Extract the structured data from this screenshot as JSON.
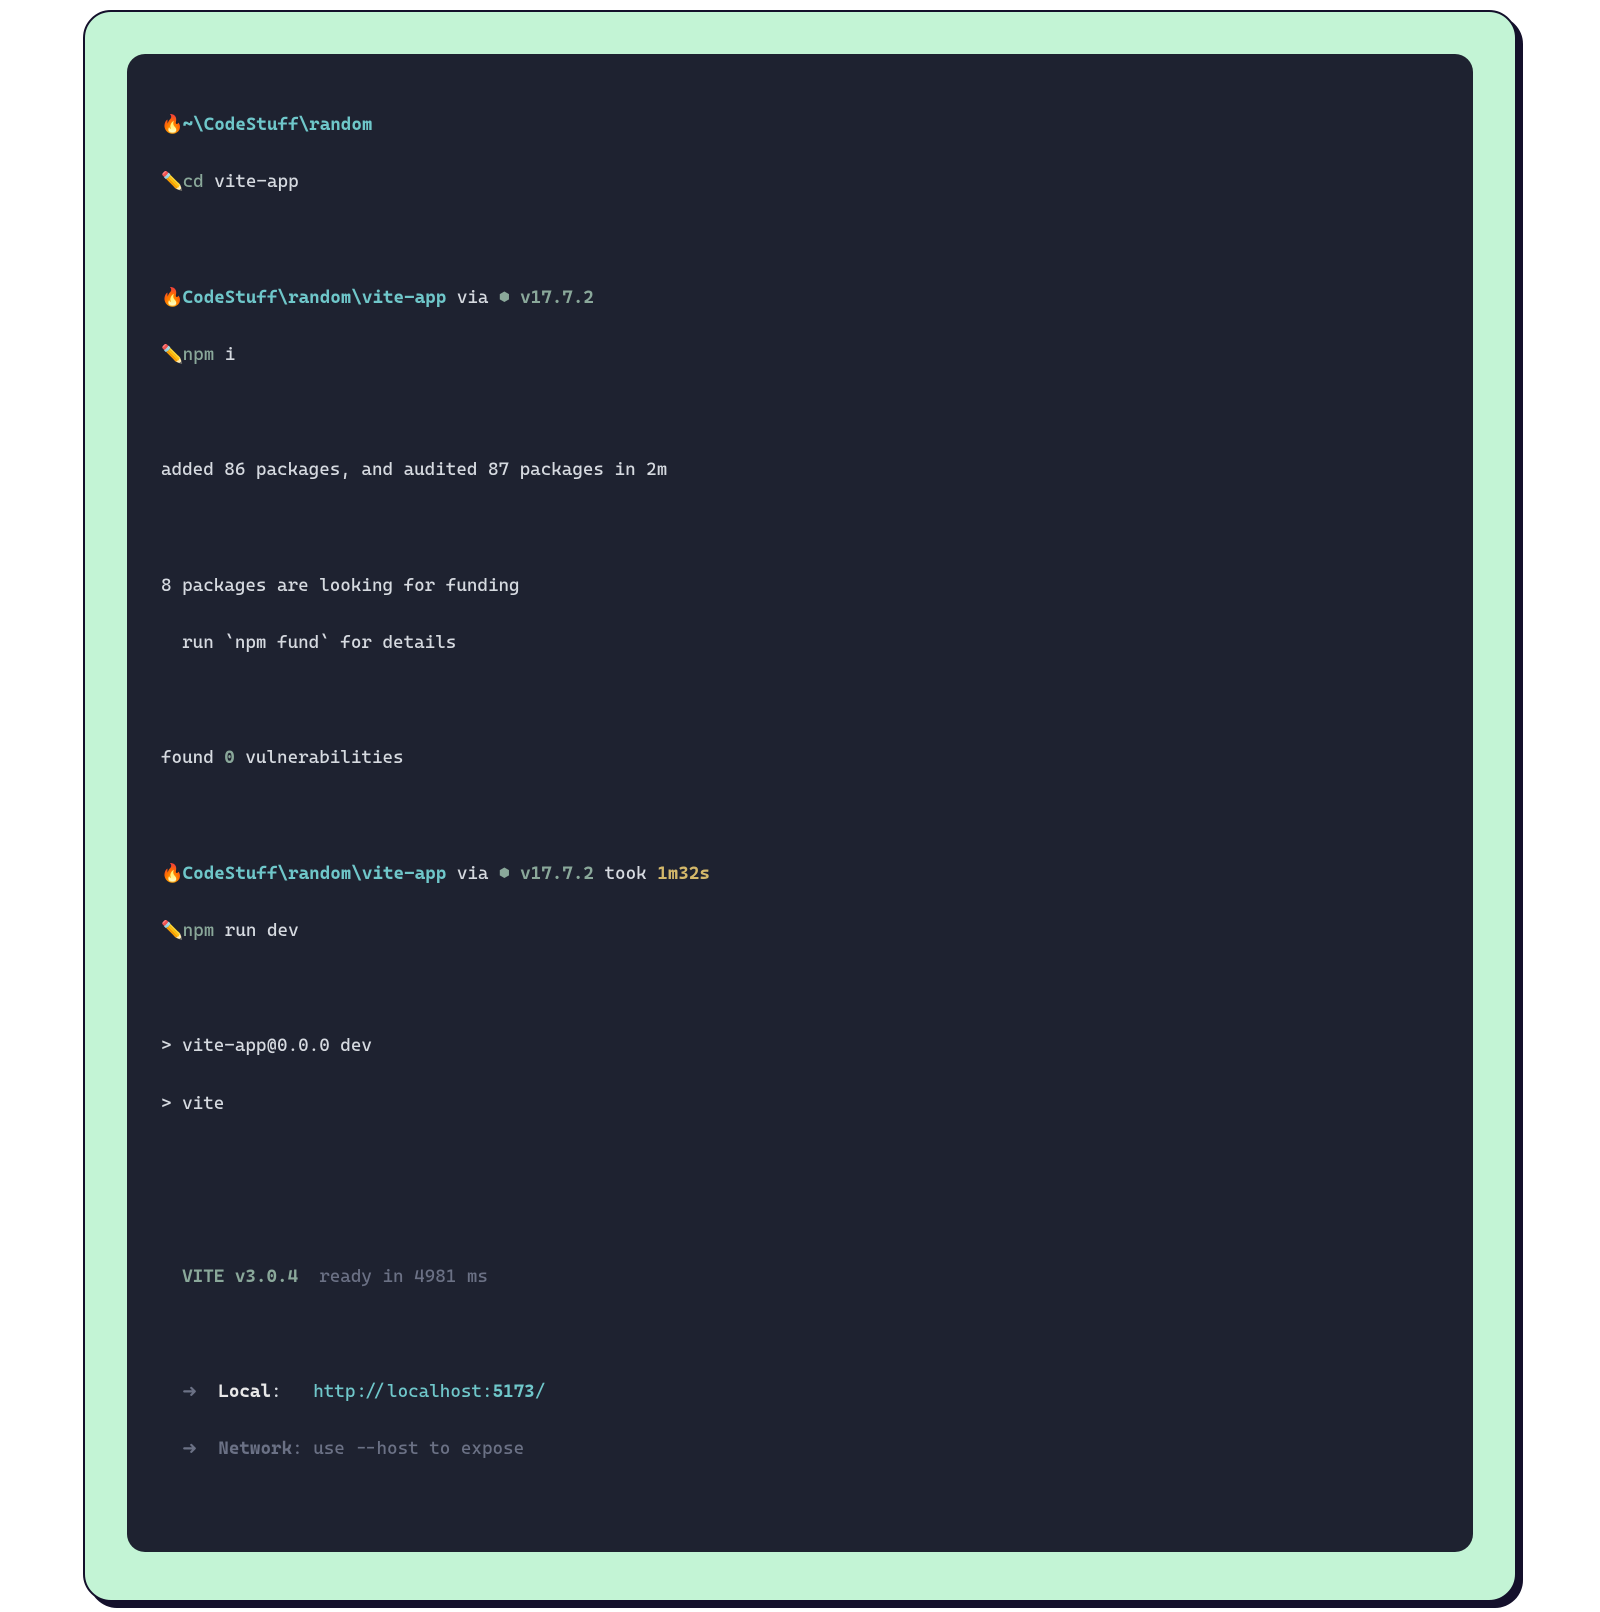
{
  "icons": {
    "fire": "🔥",
    "pencil": "✏️",
    "hex": "⬢"
  },
  "p1": {
    "path": "~\\CodeStuff\\random",
    "cmd": "cd",
    "arg": "vite-app"
  },
  "p2": {
    "path": "CodeStuff\\random\\vite-app",
    "via": "via",
    "version": "v17.7.2",
    "cmd": "npm",
    "arg": "i"
  },
  "out1": {
    "l1": "added 86 packages, and audited 87 packages in 2m",
    "l2": "8 packages are looking for funding",
    "l3": "  run `npm fund` for details",
    "l4a": "found ",
    "l4b": "0",
    "l4c": " vulnerabilities"
  },
  "p3": {
    "path": "CodeStuff\\random\\vite-app",
    "via": "via",
    "version": "v17.7.2",
    "took": "took",
    "duration": "1m32s",
    "cmd": "npm",
    "arg": "run dev"
  },
  "out2": {
    "l1": "> vite-app@0.0.0 dev",
    "l2": "> vite"
  },
  "vite": {
    "name": "VITE",
    "ver": "v3.0.4",
    "ready": "ready in 4981 ms",
    "arrow": "➜",
    "local_label": "Local",
    "local_colon": ":   ",
    "local_url_a": "http://localhost:",
    "local_url_b": "5173",
    "local_url_c": "/",
    "net_label": "Network",
    "net_colon": ": ",
    "net_hint": "use --host to expose"
  }
}
